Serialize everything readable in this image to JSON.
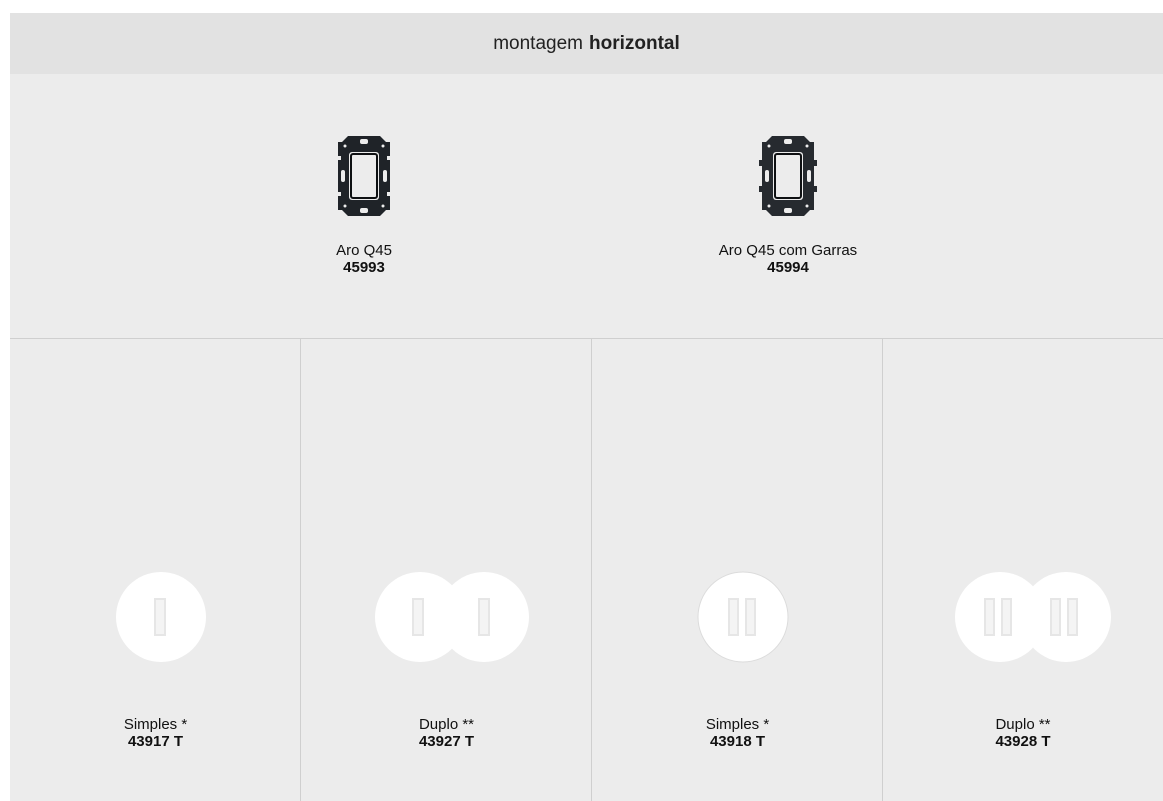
{
  "header": {
    "title_prefix": "montagem",
    "title_bold": "horizontal"
  },
  "frames": [
    {
      "label": "Aro Q45",
      "code": "45993",
      "icon": "mounting-frame-icon",
      "color": "#1f2328"
    },
    {
      "label": "Aro Q45 com Garras",
      "code": "45994",
      "icon": "mounting-frame-claws-icon",
      "color": "#1f2328"
    }
  ],
  "sockets": [
    {
      "label": "Simples *",
      "code": "43917 T",
      "icon": "single-socket-icon"
    },
    {
      "label": "Duplo **",
      "code": "43927 T",
      "icon": "double-socket-icon"
    },
    {
      "label": "Simples *",
      "code": "43918 T",
      "icon": "single-socket-double-slot-icon"
    },
    {
      "label": "Duplo **",
      "code": "43928 T",
      "icon": "double-socket-double-slot-icon"
    }
  ],
  "colors": {
    "background": "#ececec",
    "header_background": "#e2e2e2",
    "socket_white": "#ffffff",
    "slot_grey": "#e6e6e6"
  }
}
